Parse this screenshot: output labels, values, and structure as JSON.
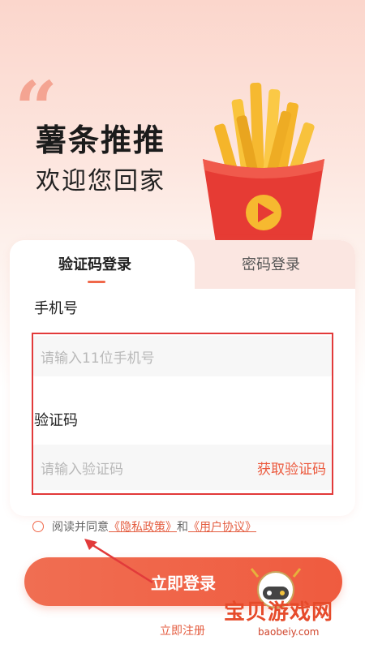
{
  "hero": {
    "quote_mark": "“",
    "title": "薯条推推",
    "subtitle": "欢迎您回家"
  },
  "tabs": [
    {
      "label": "验证码登录",
      "active": true
    },
    {
      "label": "密码登录",
      "active": false
    }
  ],
  "form": {
    "phone_label": "手机号",
    "phone_placeholder": "请输入11位手机号",
    "code_label": "验证码",
    "code_placeholder": "请输入验证码",
    "get_code": "获取验证码"
  },
  "agreement": {
    "prefix": "阅读并同意",
    "privacy": "《隐私政策》",
    "and": "和",
    "terms": "《用户协议》"
  },
  "buttons": {
    "login": "立即登录",
    "register": "立即注册"
  },
  "watermark": {
    "text": "宝贝游戏网",
    "url": "baobeiy.com"
  },
  "colors": {
    "accent": "#f0684a",
    "highlight_frame": "#e23a3a"
  }
}
